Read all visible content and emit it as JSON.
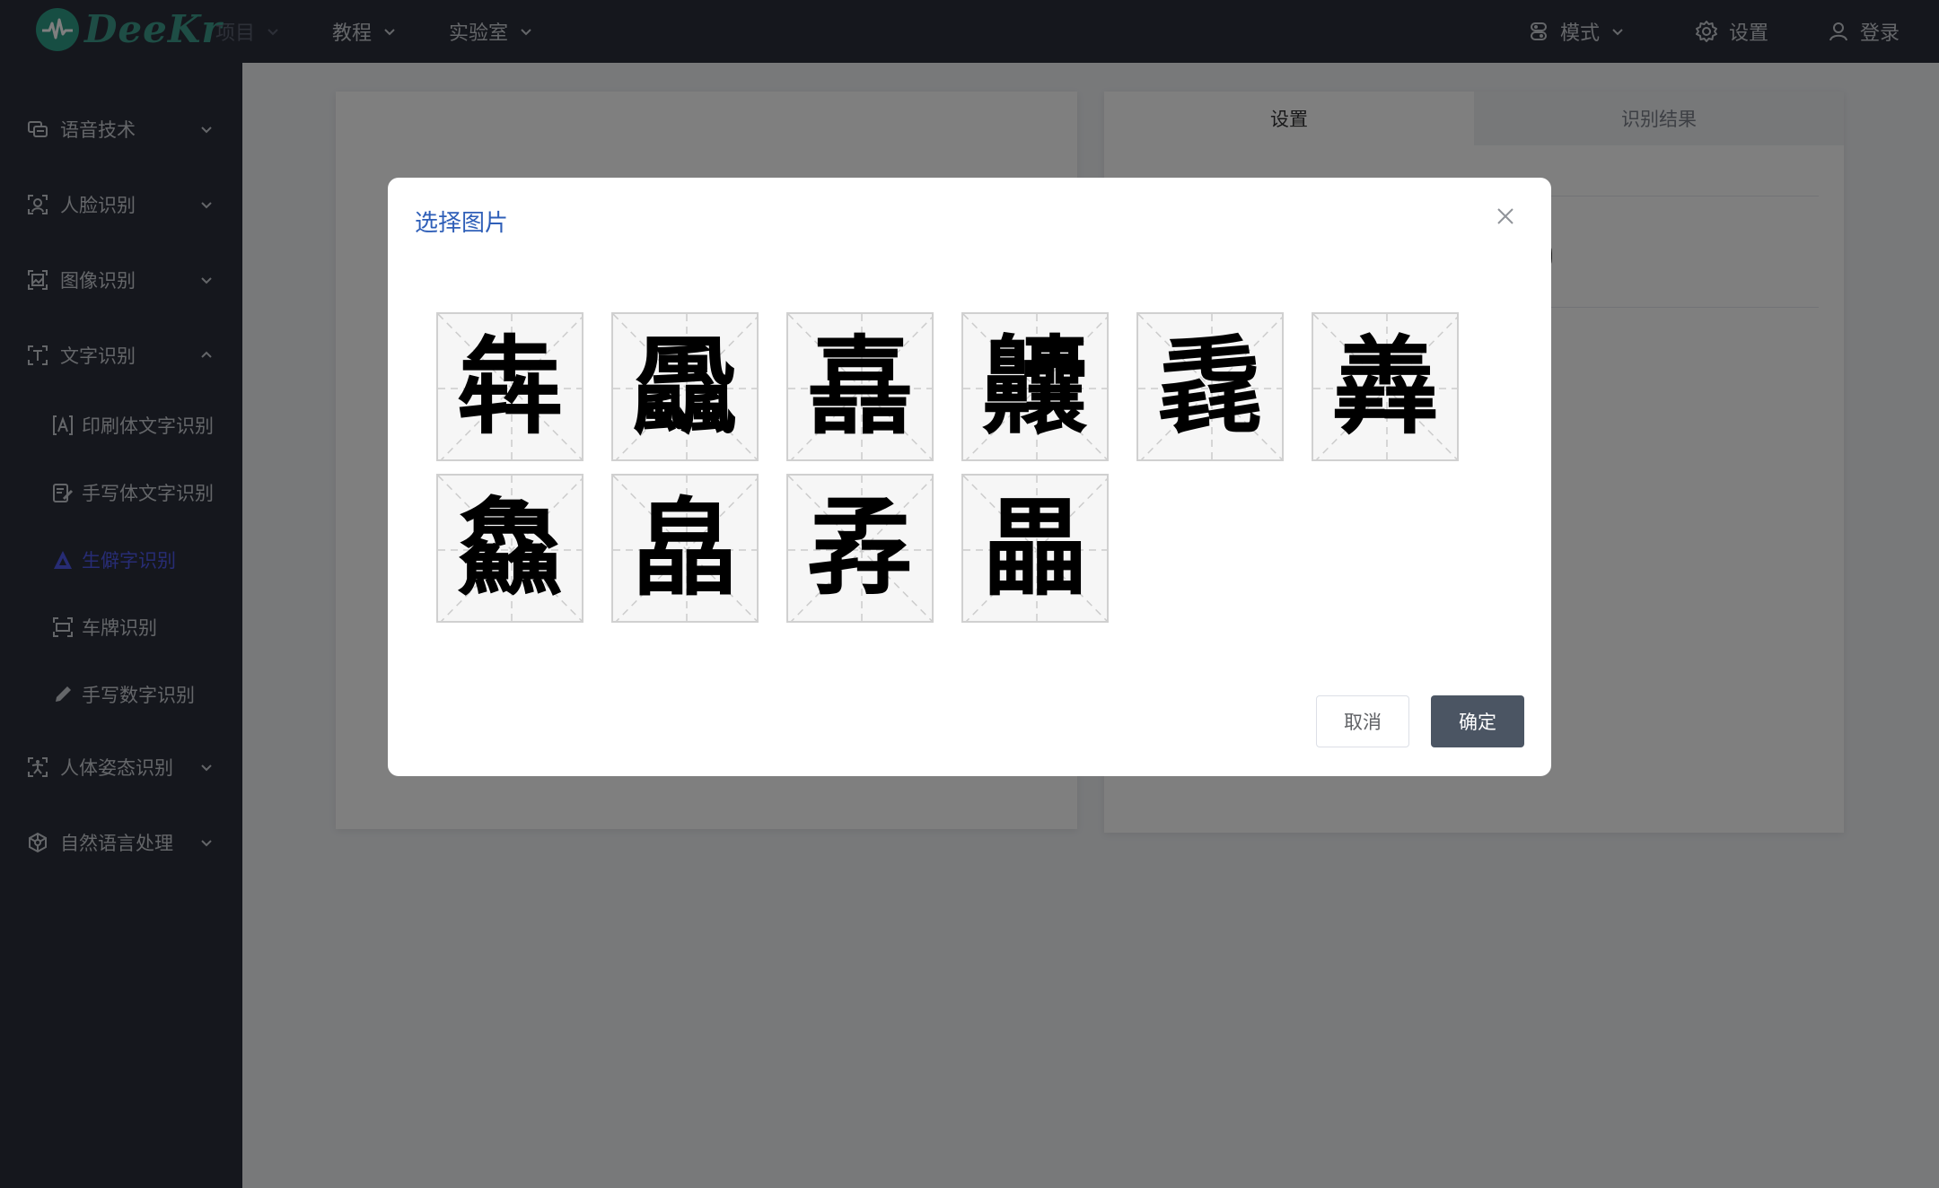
{
  "header": {
    "logo_text": "DeeKr",
    "nav": [
      {
        "label": "项目",
        "disabled": true
      },
      {
        "label": "教程",
        "disabled": false
      },
      {
        "label": "实验室",
        "disabled": false
      }
    ],
    "right": {
      "mode_label": "模式",
      "settings_label": "设置",
      "login_label": "登录"
    }
  },
  "sidebar": {
    "items": [
      {
        "label": "语音技术",
        "icon": "speech-icon",
        "expanded": false
      },
      {
        "label": "人脸识别",
        "icon": "face-icon",
        "expanded": false
      },
      {
        "label": "图像识别",
        "icon": "image-icon",
        "expanded": false
      },
      {
        "label": "文字识别",
        "icon": "text-icon",
        "expanded": true
      },
      {
        "label": "人体姿态识别",
        "icon": "body-pose-icon",
        "expanded": false
      },
      {
        "label": "自然语言处理",
        "icon": "nlp-icon",
        "expanded": false
      }
    ],
    "sub_items": [
      {
        "label": "印刷体文字识别",
        "icon": "print-text-icon",
        "active": false
      },
      {
        "label": "手写体文字识别",
        "icon": "handwriting-icon",
        "active": false
      },
      {
        "label": "生僻字识别",
        "icon": "rare-char-icon",
        "active": true
      },
      {
        "label": "车牌识别",
        "icon": "license-plate-icon",
        "active": false
      },
      {
        "label": "手写数字识别",
        "icon": "pen-icon",
        "active": false
      }
    ]
  },
  "right_panel": {
    "tabs": [
      "设置",
      "识别结果"
    ],
    "active_tab": 0
  },
  "dialog": {
    "title": "选择图片",
    "images": [
      "犇",
      "飍",
      "嚞",
      "齉",
      "毳",
      "羴",
      "鱻",
      "皛",
      "孨",
      "畾"
    ],
    "cancel_label": "取消",
    "ok_label": "确定"
  },
  "colors": {
    "header_bg": "#2b2f3a",
    "active_menu": "#4e58e8",
    "dialog_title": "#2f5fb8",
    "primary_button": "#4b5563"
  }
}
